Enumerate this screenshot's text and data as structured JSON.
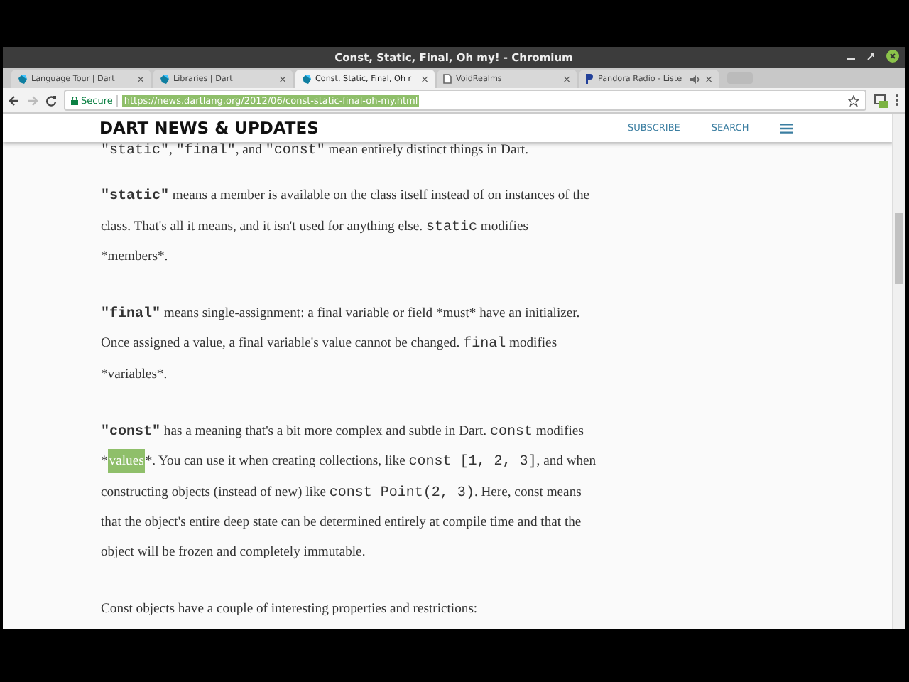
{
  "window": {
    "title": "Const, Static, Final, Oh my! - Chromium"
  },
  "tabs": [
    {
      "label": "Language Tour | Dart",
      "kind": "dart",
      "selected": false,
      "close": "×"
    },
    {
      "label": "Libraries | Dart",
      "kind": "dart",
      "selected": false,
      "close": "×"
    },
    {
      "label": "Const, Static, Final, Oh r",
      "kind": "dart",
      "selected": true,
      "close": "×"
    },
    {
      "label": "VoidRealms",
      "kind": "page",
      "selected": false,
      "close": "×"
    },
    {
      "label": "Pandora Radio - Liste",
      "kind": "pandora",
      "selected": false,
      "audio": true,
      "close": "×"
    }
  ],
  "toolbar": {
    "forward_disabled": true,
    "security": "Secure",
    "url": "https://news.dartlang.org/2012/06/const-static-final-oh-my.html",
    "url_selected": true
  },
  "site_header": {
    "title": "DART NEWS & UPDATES",
    "links": [
      "SUBSCRIBE",
      "SEARCH"
    ]
  },
  "paragraphs": [
    {
      "lines": [
        [
          {
            "kind": "code",
            "text": "\"static\""
          },
          {
            "kind": "text",
            "text": ", "
          },
          {
            "kind": "code",
            "text": "\"final\""
          },
          {
            "kind": "text",
            "text": ", and "
          },
          {
            "kind": "code",
            "text": "\"const\""
          },
          {
            "kind": "text",
            "text": " mean entirely distinct things in Dart."
          }
        ]
      ]
    },
    {
      "lines": [
        [
          {
            "kind": "bold",
            "text": "\"static\""
          },
          {
            "kind": "text",
            "text": " means a member is available on the class itself instead of on instances of the"
          }
        ],
        [
          {
            "kind": "text",
            "text": "class. That's all it means, and it isn't used for anything else. "
          },
          {
            "kind": "code",
            "text": "static"
          },
          {
            "kind": "text",
            "text": " modifies"
          }
        ],
        [
          {
            "kind": "text",
            "text": "*members*."
          }
        ]
      ]
    },
    {
      "lines": [
        [
          {
            "kind": "bold",
            "text": "\"final\""
          },
          {
            "kind": "text",
            "text": " means single-assignment: a final variable or field *must* have an initializer."
          }
        ],
        [
          {
            "kind": "text",
            "text": "Once assigned a value, a final variable's value cannot be changed. "
          },
          {
            "kind": "code",
            "text": "final"
          },
          {
            "kind": "text",
            "text": " modifies"
          }
        ],
        [
          {
            "kind": "text",
            "text": "*variables*."
          }
        ]
      ]
    },
    {
      "lines": [
        [
          {
            "kind": "bold",
            "text": "\"const\""
          },
          {
            "kind": "text",
            "text": " has a meaning that's a bit more complex and subtle in Dart. "
          },
          {
            "kind": "code",
            "text": "const"
          },
          {
            "kind": "text",
            "text": " modifies"
          }
        ],
        [
          {
            "kind": "text",
            "text": "*"
          },
          {
            "kind": "selected",
            "text": "values"
          },
          {
            "kind": "text",
            "text": "*. You can use it when creating collections, like "
          },
          {
            "kind": "code",
            "text": "const [1, 2, 3]"
          },
          {
            "kind": "text",
            "text": ", and when"
          }
        ],
        [
          {
            "kind": "text",
            "text": "constructing objects (instead of new) like "
          },
          {
            "kind": "code",
            "text": "const Point(2, 3)"
          },
          {
            "kind": "text",
            "text": ". Here, const means"
          }
        ],
        [
          {
            "kind": "text",
            "text": "that the object's entire deep state can be determined entirely at compile time and that the"
          }
        ],
        [
          {
            "kind": "text",
            "text": "object will be frozen and completely immutable."
          }
        ]
      ]
    },
    {
      "lines": [
        [
          {
            "kind": "text",
            "text": "Const objects have a couple of interesting properties and restrictions:"
          }
        ]
      ]
    }
  ]
}
